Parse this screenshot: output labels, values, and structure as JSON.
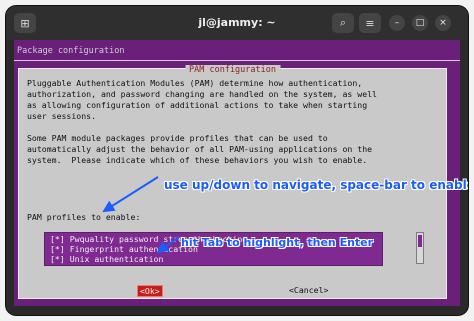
{
  "window": {
    "title": "jl@jammy: ~",
    "new_tab_icon": "⊞",
    "search_icon": "⌕",
    "menu_icon": "≡",
    "minimize": "–",
    "maximize": "□",
    "close": "×"
  },
  "terminal": {
    "header": "Package configuration",
    "dialog": {
      "title": "PAM configuration",
      "body": "Pluggable Authentication Modules (PAM) determine how authentication,\nauthorization, and password changing are handled on the system, as well\nas allowing configuration of additional actions to take when starting\nuser sessions.\n\nSome PAM module packages provide profiles that can be used to\nautomatically adjust the behavior of all PAM-using applications on the\nsystem.  Please indicate which of these behaviors you wish to enable.",
      "profiles_label": "PAM profiles to enable:",
      "items": [
        "[*] Pwquality password strength checking",
        "[*] Fingerprint authentication",
        "[*] Unix authentication"
      ],
      "ok_label": "<Ok>",
      "cancel_label": "<Cancel>"
    }
  },
  "annotations": {
    "navigate": "use up/down to navigate, space-bar to enable",
    "tab": "hit Tab to highlight, then Enter"
  },
  "colors": {
    "terminal_bg": "#6a1f7a",
    "dialog_bg": "#c9c9c9",
    "accent": "#7e2a91",
    "ok_bg": "#c51c1c",
    "annotation": "#1b5cff"
  }
}
